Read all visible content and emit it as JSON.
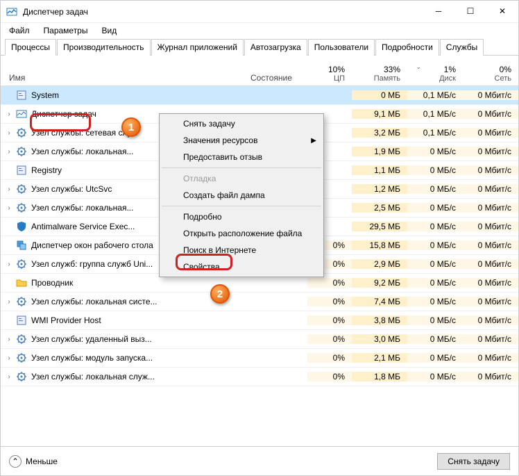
{
  "window": {
    "title": "Диспетчер задач"
  },
  "menu": {
    "file": "Файл",
    "options": "Параметры",
    "view": "Вид"
  },
  "tabs": [
    {
      "label": "Процессы",
      "active": true
    },
    {
      "label": "Производительность"
    },
    {
      "label": "Журнал приложений"
    },
    {
      "label": "Автозагрузка"
    },
    {
      "label": "Пользователи"
    },
    {
      "label": "Подробности"
    },
    {
      "label": "Службы"
    }
  ],
  "columns": {
    "name": "Имя",
    "state": "Состояние",
    "cpu_pct": "10%",
    "cpu_label": "ЦП",
    "mem_pct": "33%",
    "mem_label": "Память",
    "disk_pct": "1%",
    "disk_label": "Диск",
    "net_pct": "0%",
    "net_label": "Сеть"
  },
  "rows": [
    {
      "expand": false,
      "icon": "system",
      "name": "System",
      "cpu": "",
      "mem": "0 МБ",
      "disk": "0,1 МБ/с",
      "net": "0 Мбит/с",
      "selected": true
    },
    {
      "expand": true,
      "icon": "taskmgr",
      "name": "Диспетчер задач",
      "cpu": "",
      "mem": "9,1 МБ",
      "disk": "0,1 МБ/с",
      "net": "0 Мбит/с"
    },
    {
      "expand": true,
      "icon": "service",
      "name": "Узел службы: сетевая слу...",
      "cpu": "",
      "mem": "3,2 МБ",
      "disk": "0,1 МБ/с",
      "net": "0 Мбит/с"
    },
    {
      "expand": true,
      "icon": "service",
      "name": "Узел службы: локальная...",
      "cpu": "",
      "mem": "1,9 МБ",
      "disk": "0 МБ/с",
      "net": "0 Мбит/с"
    },
    {
      "expand": false,
      "icon": "registry",
      "name": "Registry",
      "cpu": "",
      "mem": "1,1 МБ",
      "disk": "0 МБ/с",
      "net": "0 Мбит/с"
    },
    {
      "expand": true,
      "icon": "service",
      "name": "Узел службы: UtcSvc",
      "cpu": "",
      "mem": "1,2 МБ",
      "disk": "0 МБ/с",
      "net": "0 Мбит/с"
    },
    {
      "expand": true,
      "icon": "service",
      "name": "Узел службы: локальная...",
      "cpu": "",
      "mem": "2,5 МБ",
      "disk": "0 МБ/с",
      "net": "0 Мбит/с"
    },
    {
      "expand": false,
      "icon": "shield",
      "name": "Antimalware Service Exec...",
      "cpu": "",
      "mem": "29,5 МБ",
      "disk": "0 МБ/с",
      "net": "0 Мбит/с"
    },
    {
      "expand": false,
      "icon": "dwm",
      "name": "Диспетчер окон рабочего стола",
      "cpu": "0%",
      "mem": "15,8 МБ",
      "disk": "0 МБ/с",
      "net": "0 Мбит/с"
    },
    {
      "expand": true,
      "icon": "service",
      "name": "Узел служб: группа служб Uni...",
      "cpu": "0%",
      "mem": "2,9 МБ",
      "disk": "0 МБ/с",
      "net": "0 Мбит/с"
    },
    {
      "expand": false,
      "icon": "explorer",
      "name": "Проводник",
      "cpu": "0%",
      "mem": "9,2 МБ",
      "disk": "0 МБ/с",
      "net": "0 Мбит/с"
    },
    {
      "expand": true,
      "icon": "service",
      "name": "Узел службы: локальная систе...",
      "cpu": "0%",
      "mem": "7,4 МБ",
      "disk": "0 МБ/с",
      "net": "0 Мбит/с"
    },
    {
      "expand": false,
      "icon": "wmi",
      "name": "WMI Provider Host",
      "cpu": "0%",
      "mem": "3,8 МБ",
      "disk": "0 МБ/с",
      "net": "0 Мбит/с"
    },
    {
      "expand": true,
      "icon": "service",
      "name": "Узел службы: удаленный выз...",
      "cpu": "0%",
      "mem": "3,0 МБ",
      "disk": "0 МБ/с",
      "net": "0 Мбит/с"
    },
    {
      "expand": true,
      "icon": "service",
      "name": "Узел службы: модуль запуска...",
      "cpu": "0%",
      "mem": "2,1 МБ",
      "disk": "0 МБ/с",
      "net": "0 Мбит/с"
    },
    {
      "expand": true,
      "icon": "service",
      "name": "Узел службы: локальная служ...",
      "cpu": "0%",
      "mem": "1,8 МБ",
      "disk": "0 МБ/с",
      "net": "0 Мбит/с"
    }
  ],
  "context_menu": {
    "end_task": "Снять задачу",
    "resource_values": "Значения ресурсов",
    "feedback": "Предоставить отзыв",
    "debug": "Отладка",
    "create_dump": "Создать файл дампа",
    "details": "Подробно",
    "open_location": "Открыть расположение файла",
    "search_online": "Поиск в Интернете",
    "properties": "Свойства"
  },
  "footer": {
    "less": "Меньше",
    "end_task_btn": "Снять задачу"
  },
  "badges": {
    "one": "1",
    "two": "2"
  }
}
